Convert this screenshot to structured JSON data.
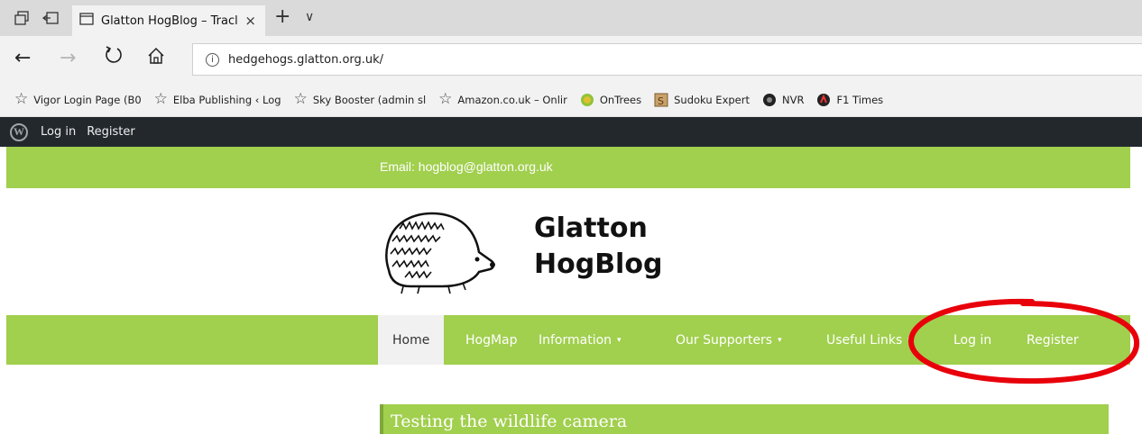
{
  "browser": {
    "tab_title": "Glatton HogBlog – Tracl",
    "close_glyph": "×",
    "new_tab_glyph": "+",
    "tab_list_glyph": "∨",
    "address_url": "hedgehogs.glatton.org.uk/",
    "favorites": [
      {
        "label": "Vigor Login Page (B0",
        "icon": "star-icon"
      },
      {
        "label": "Elba Publishing ‹ Log",
        "icon": "star-icon"
      },
      {
        "label": "Sky Booster (admin sl",
        "icon": "star-icon"
      },
      {
        "label": "Amazon.co.uk – Onlir",
        "icon": "star-icon"
      },
      {
        "label": "OnTrees",
        "icon": "ontrees-icon"
      },
      {
        "label": "Sudoku Expert",
        "icon": "sudoku-icon"
      },
      {
        "label": "NVR",
        "icon": "nvr-icon"
      },
      {
        "label": "F1 Times",
        "icon": "f1-icon"
      }
    ]
  },
  "admin_bar": {
    "login": "Log in",
    "register": "Register"
  },
  "site": {
    "email": "Email: hogblog@glatton.org.uk",
    "title_line1": "Glatton",
    "title_line2": "HogBlog",
    "menu": [
      {
        "label": "Home",
        "active": true
      },
      {
        "label": "HogMap"
      },
      {
        "label": "Information",
        "dropdown": true
      },
      {
        "label": "Our Supporters",
        "dropdown": true
      },
      {
        "label": "Useful Links",
        "dropdown": true
      },
      {
        "label": "Log in"
      },
      {
        "label": "Register"
      }
    ],
    "caret": "▾",
    "post_title": "Testing the wildlife camera"
  },
  "colors": {
    "accent_green": "#a1cf4e",
    "admin_bar": "#23282d",
    "annotation_red": "#e8000b"
  }
}
